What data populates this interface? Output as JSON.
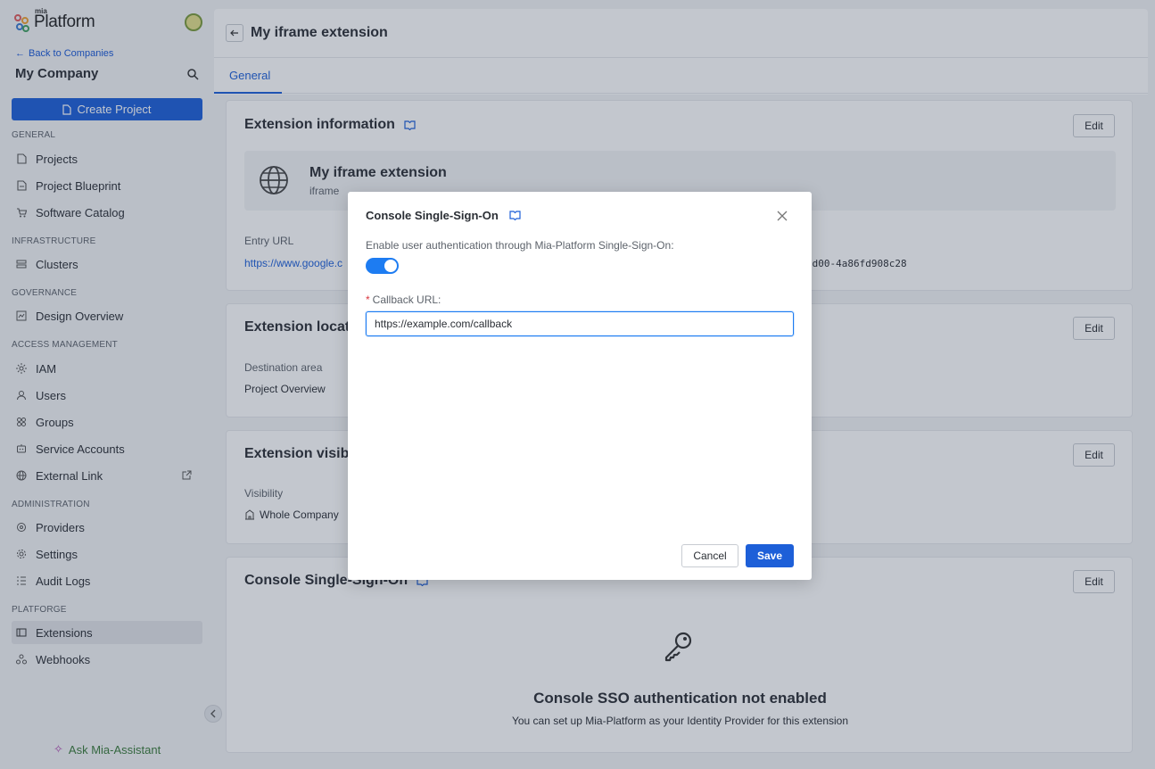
{
  "brand": {
    "small": "mia",
    "name": "Platform"
  },
  "sidebar": {
    "back_link": "Back to Companies",
    "company": "My Company",
    "create_button": "Create Project",
    "sections": {
      "general": "GENERAL",
      "infrastructure": "INFRASTRUCTURE",
      "governance": "GOVERNANCE",
      "access": "ACCESS MANAGEMENT",
      "administration": "ADMINISTRATION",
      "platforge": "PLATFORGE"
    },
    "items": {
      "projects": "Projects",
      "blueprint": "Project Blueprint",
      "catalog": "Software Catalog",
      "clusters": "Clusters",
      "design": "Design Overview",
      "iam": "IAM",
      "users": "Users",
      "groups": "Groups",
      "service_accounts": "Service Accounts",
      "external_link": "External Link",
      "providers": "Providers",
      "settings": "Settings",
      "audit": "Audit Logs",
      "extensions": "Extensions",
      "webhooks": "Webhooks"
    },
    "assistant": "Ask Mia-Assistant"
  },
  "page": {
    "title": "My iframe extension",
    "tab": "General"
  },
  "cards": {
    "info": {
      "title": "Extension information",
      "edit": "Edit",
      "ext_name": "My iframe extension",
      "ext_type": "iframe",
      "entry_url_label": "Entry URL",
      "entry_url": "https://www.google.c",
      "id_fragment": "3d00-4a86fd908c28"
    },
    "location": {
      "title": "Extension locati",
      "edit": "Edit",
      "dest_label": "Destination area",
      "dest_value": "Project Overview"
    },
    "visibility": {
      "title": "Extension visibil",
      "edit": "Edit",
      "vis_label": "Visibility",
      "vis_value": "Whole Company"
    },
    "sso": {
      "title": "Console Single-Sign-On",
      "edit": "Edit",
      "empty_title": "Console SSO authentication not enabled",
      "empty_text": "You can set up Mia-Platform as your Identity Provider for this extension"
    }
  },
  "modal": {
    "title": "Console Single-Sign-On",
    "toggle_label": "Enable user authentication through Mia-Platform Single-Sign-On:",
    "toggle_on": true,
    "field_label": "Callback URL:",
    "field_value": "https://example.com/callback",
    "cancel": "Cancel",
    "save": "Save"
  },
  "colors": {
    "accent": "#1d5fd8",
    "toggle": "#1d7cf2",
    "required": "#d9363e"
  }
}
